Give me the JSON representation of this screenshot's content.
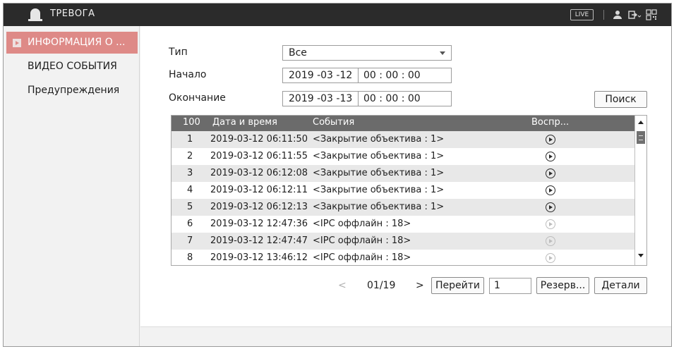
{
  "app": {
    "title": "ТРЕВОГА",
    "live_label": "LIVE",
    "accent_color": "#de8a87",
    "icons": [
      "alarm-bell-icon",
      "user-icon",
      "logout-icon",
      "qr-code-icon"
    ]
  },
  "sidebar": {
    "items": [
      {
        "label": "ИНФОРМАЦИЯ О ...",
        "active": true
      },
      {
        "label": "ВИДЕО СОБЫТИЯ",
        "active": false
      },
      {
        "label": "Предупреждения",
        "active": false
      }
    ]
  },
  "form": {
    "type_label": "Тип",
    "type_value": "Все",
    "start_label": "Начало",
    "start_date": "2019 -03 -12",
    "start_time": "00 : 00 : 00",
    "end_label": "Окончание",
    "end_date": "2019 -03 -13",
    "end_time": "00 : 00 : 00",
    "search_label": "Поиск"
  },
  "table": {
    "columns": [
      "100",
      "Дата и время",
      "События",
      "Воспр..."
    ],
    "rows": [
      {
        "num": "1",
        "datetime": "2019-03-12 06:11:50",
        "event": "<Закрытие объектива : 1>",
        "playable": true
      },
      {
        "num": "2",
        "datetime": "2019-03-12 06:11:55",
        "event": "<Закрытие объектива : 1>",
        "playable": true
      },
      {
        "num": "3",
        "datetime": "2019-03-12 06:12:08",
        "event": "<Закрытие объектива : 1>",
        "playable": true
      },
      {
        "num": "4",
        "datetime": "2019-03-12 06:12:11",
        "event": "<Закрытие объектива : 1>",
        "playable": true
      },
      {
        "num": "5",
        "datetime": "2019-03-12 06:12:13",
        "event": "<Закрытие объектива : 1>",
        "playable": true
      },
      {
        "num": "6",
        "datetime": "2019-03-12 12:47:36",
        "event": "<IPC оффлайн : 18>",
        "playable": false
      },
      {
        "num": "7",
        "datetime": "2019-03-12 12:47:47",
        "event": "<IPC оффлайн : 18>",
        "playable": false
      },
      {
        "num": "8",
        "datetime": "2019-03-12 13:46:12",
        "event": "<IPC оффлайн : 18>",
        "playable": false
      }
    ]
  },
  "pager": {
    "prev": "<",
    "page": "01/19",
    "next": ">",
    "goto_label": "Перейти",
    "goto_value": "1",
    "backup_label": "Резерв...",
    "details_label": "Детали"
  }
}
